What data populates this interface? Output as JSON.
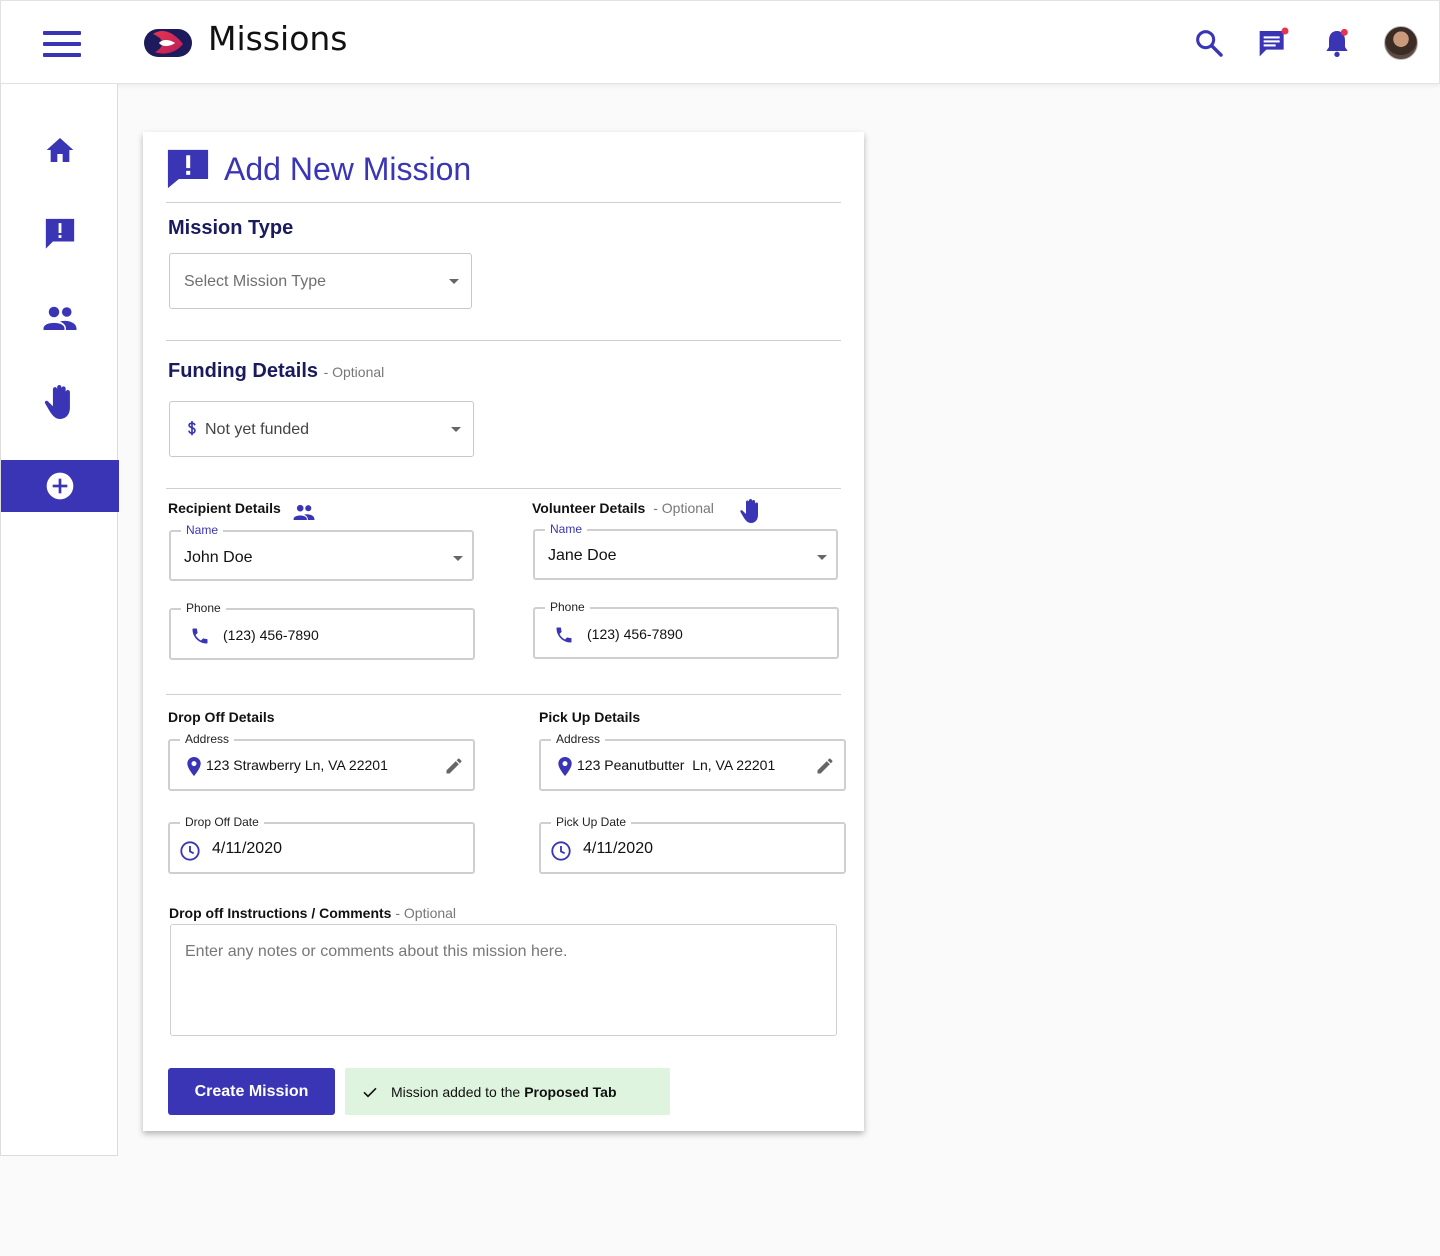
{
  "header": {
    "app_title": "Missions",
    "icons": [
      "menu-icon",
      "logo",
      "search-icon",
      "chat-icon",
      "bell-icon",
      "avatar"
    ],
    "accent_color": "#3a35b5",
    "notification_dot_color": "#e8344f"
  },
  "sidebar": {
    "items": [
      {
        "icon": "home-icon",
        "active": false
      },
      {
        "icon": "alert-message-icon",
        "active": false
      },
      {
        "icon": "people-icon",
        "active": false
      },
      {
        "icon": "hand-icon",
        "active": false
      },
      {
        "icon": "add-circle-icon",
        "active": true
      }
    ]
  },
  "form": {
    "title": "Add New Mission",
    "mission_type": {
      "heading": "Mission Type",
      "placeholder": "Select Mission Type"
    },
    "funding": {
      "heading": "Funding Details",
      "optional": "- Optional",
      "value": "Not yet funded"
    },
    "recipient": {
      "heading": "Recipient Details",
      "name_label": "Name",
      "name_value": "John Doe",
      "phone_label": "Phone",
      "phone_value": "(123) 456-7890"
    },
    "volunteer": {
      "heading": "Volunteer Details",
      "optional": "- Optional",
      "name_label": "Name",
      "name_value": "Jane Doe",
      "phone_label": "Phone",
      "phone_value": "(123) 456-7890"
    },
    "drop_off": {
      "heading": "Drop Off Details",
      "address_label": "Address",
      "address_value": "123 Strawberry Ln, VA 22201",
      "date_label": "Drop Off Date",
      "date_value": "4/11/2020"
    },
    "pick_up": {
      "heading": "Pick Up Details",
      "address_label": "Address",
      "address_value": "123 Peanutbutter  Ln, VA 22201",
      "date_label": "Pick Up Date",
      "date_value": "4/11/2020"
    },
    "notes": {
      "heading": "Drop off Instructions / Comments",
      "optional": "- Optional",
      "placeholder": "Enter any notes or comments about this mission here."
    },
    "submit_label": "Create Mission",
    "toast": {
      "prefix": "Mission added to the",
      "bold": "Proposed Tab",
      "background": "#dff4de"
    }
  }
}
